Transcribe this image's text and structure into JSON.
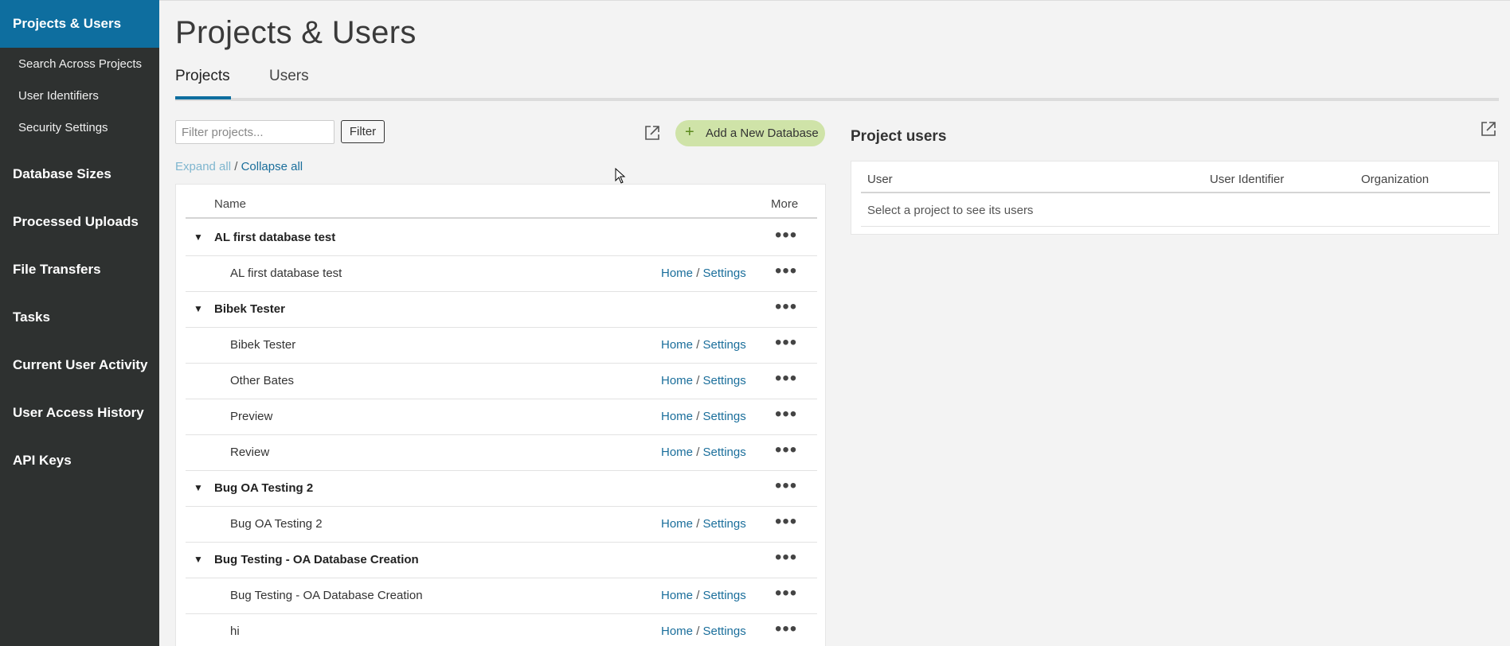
{
  "sidebar": {
    "active": "Projects & Users",
    "sub_items": [
      "Search Across Projects",
      "User Identifiers",
      "Security Settings"
    ],
    "items": [
      "Database Sizes",
      "Processed Uploads",
      "File Transfers",
      "Tasks",
      "Current User Activity",
      "User Access History",
      "API Keys"
    ]
  },
  "page": {
    "title": "Projects & Users",
    "tabs": [
      "Projects",
      "Users"
    ]
  },
  "toolbar": {
    "filter_placeholder": "Filter projects...",
    "filter_button": "Filter",
    "add_database": "Add a New Database",
    "expand_all": "Expand all",
    "separator": "/",
    "collapse_all": "Collapse all"
  },
  "projects_table": {
    "col_name": "Name",
    "col_more": "More",
    "home_label": "Home",
    "link_sep": "/",
    "settings_label": "Settings",
    "more_glyph": "•••",
    "rows": [
      {
        "type": "group",
        "name": "AL first database test"
      },
      {
        "type": "child",
        "name": "AL first database test"
      },
      {
        "type": "group",
        "name": "Bibek Tester"
      },
      {
        "type": "child",
        "name": "Bibek Tester"
      },
      {
        "type": "child",
        "name": "Other Bates"
      },
      {
        "type": "child",
        "name": "Preview"
      },
      {
        "type": "child",
        "name": "Review"
      },
      {
        "type": "group",
        "name": "Bug OA Testing 2"
      },
      {
        "type": "child",
        "name": "Bug OA Testing 2"
      },
      {
        "type": "group",
        "name": "Bug Testing - OA Database Creation"
      },
      {
        "type": "child",
        "name": "Bug Testing - OA Database Creation"
      },
      {
        "type": "child",
        "name": "hi"
      }
    ]
  },
  "project_users": {
    "title": "Project users",
    "col_user": "User",
    "col_identifier": "User Identifier",
    "col_organization": "Organization",
    "empty_message": "Select a project to see its users"
  },
  "colors": {
    "sidebar_bg": "#2e3130",
    "active_bg": "#0e6e9f",
    "link": "#1a6e9b",
    "add_button_bg": "#cfe3a8"
  }
}
